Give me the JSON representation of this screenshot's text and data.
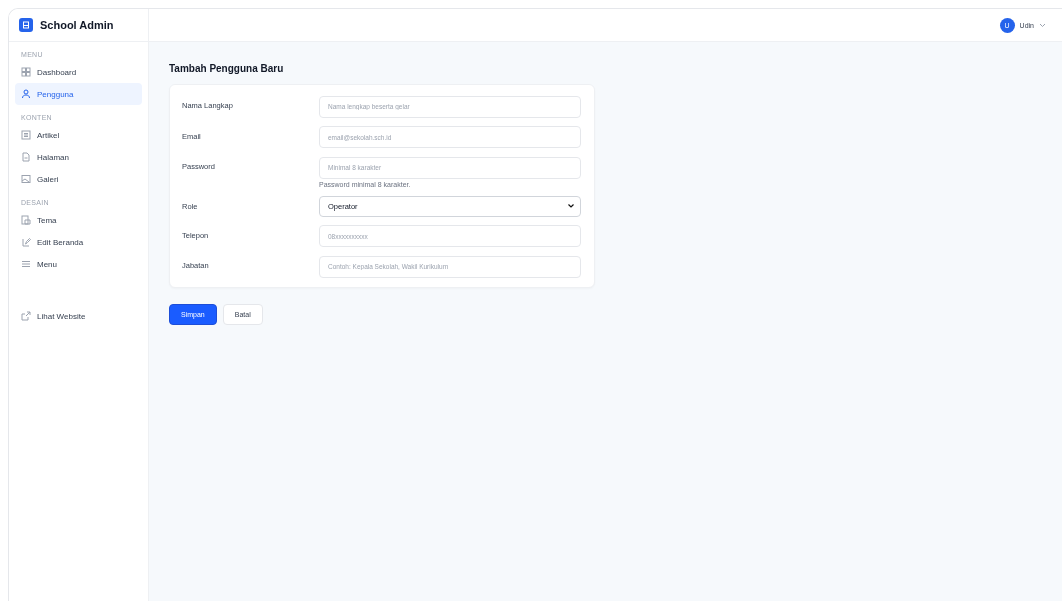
{
  "brand": {
    "title": "School Admin"
  },
  "sidebar": {
    "sections": [
      {
        "heading": "MENU",
        "items": [
          {
            "label": "Dashboard",
            "selected": false
          },
          {
            "label": "Pengguna",
            "selected": true
          }
        ]
      },
      {
        "heading": "KONTEN",
        "items": [
          {
            "label": "Artikel",
            "selected": false
          },
          {
            "label": "Halaman",
            "selected": false
          },
          {
            "label": "Galeri",
            "selected": false
          }
        ]
      },
      {
        "heading": "DESAIN",
        "items": [
          {
            "label": "Tema",
            "selected": false
          },
          {
            "label": "Edit Beranda",
            "selected": false
          },
          {
            "label": "Menu",
            "selected": false
          }
        ]
      }
    ],
    "footer_link": "Lihat Website"
  },
  "user": {
    "initial": "U",
    "name": "Udin"
  },
  "page_title": "Tambah Pengguna Baru",
  "form": {
    "fields": [
      {
        "kind": "text",
        "label": "Nama Langkap",
        "placeholder": "Nama lengkap beserta gelar"
      },
      {
        "kind": "text",
        "label": "Email",
        "placeholder": "email@sekolah.sch.id"
      },
      {
        "kind": "text",
        "label": "Password",
        "placeholder": "Minimal 8 karakter",
        "hint": "Password minimal 8 karakter."
      },
      {
        "kind": "select",
        "label": "Role",
        "value": "Operator"
      },
      {
        "kind": "text",
        "label": "Telepon",
        "placeholder": "08xxxxxxxxxx"
      },
      {
        "kind": "text",
        "label": "Jabatan",
        "placeholder": "Contoh: Kepala Sekolah, Wakil Kurikulum"
      }
    ]
  },
  "buttons": [
    {
      "label": "Simpan",
      "kind": "primary"
    },
    {
      "label": "Batal",
      "kind": "secondary"
    }
  ]
}
